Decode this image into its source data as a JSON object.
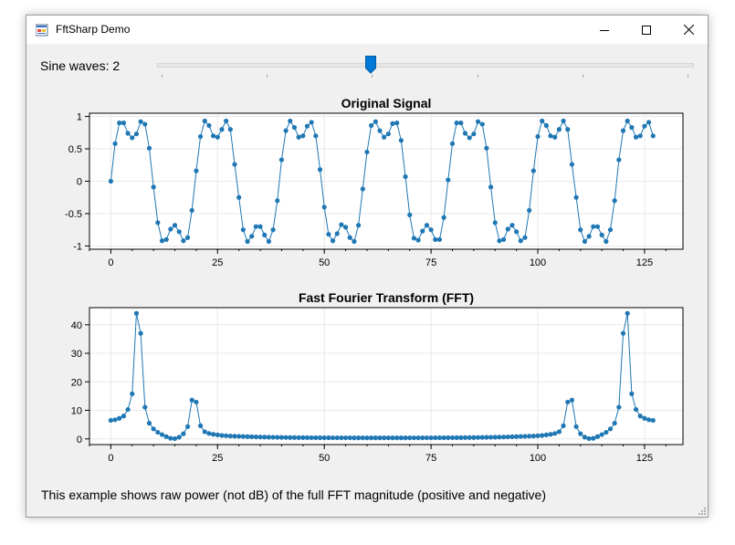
{
  "window": {
    "title": "FftSharp Demo"
  },
  "controls": {
    "sine_label": "Sine waves: 2",
    "slider": {
      "fraction": 0.4,
      "tick_count": 6
    }
  },
  "footer_text": "This example shows raw power (not dB) of the full FFT magnitude (positive and negative)",
  "colors": {
    "series": "#1f77b4",
    "grid": "#e8e8e8",
    "accent": "#0078d7"
  },
  "chart_data": [
    {
      "type": "line",
      "title": "Original Signal",
      "xlim": [
        -5,
        134
      ],
      "ylim": [
        -1.05,
        1.05
      ],
      "xticks": [
        0,
        25,
        50,
        75,
        100,
        125
      ],
      "yticks": [
        1,
        0.5,
        0,
        -0.5,
        -1
      ],
      "ytick_labels": [
        "1",
        "0.5",
        "0",
        "-0.5",
        "-1"
      ],
      "grid": true,
      "series": [
        {
          "y": [
            0,
            0.58,
            0.9,
            0.9,
            0.74,
            0.67,
            0.73,
            0.92,
            0.88,
            0.51,
            -0.09,
            -0.64,
            -0.92,
            -0.9,
            -0.74,
            -0.68,
            -0.78,
            -0.92,
            -0.87,
            -0.45,
            0.16,
            0.69,
            0.93,
            0.86,
            0.7,
            0.68,
            0.8,
            0.93,
            0.8,
            0.26,
            -0.25,
            -0.75,
            -0.93,
            -0.85,
            -0.7,
            -0.7,
            -0.83,
            -0.93,
            -0.75,
            -0.3,
            0.33,
            0.78,
            0.93,
            0.83,
            0.68,
            0.7,
            0.85,
            0.91,
            0.7,
            0.18,
            -0.4,
            -0.82,
            -0.92,
            -0.81,
            -0.67,
            -0.71,
            -0.87,
            -0.93,
            -0.68,
            -0.12,
            0.45,
            0.86,
            0.92,
            0.78,
            0.68,
            0.73,
            0.89,
            0.9,
            0.63,
            0.07,
            -0.52,
            -0.88,
            -0.91,
            -0.77,
            -0.68,
            -0.75,
            -0.9,
            -0.9,
            -0.56,
            0.02,
            0.58,
            0.9,
            0.9,
            0.74,
            0.67,
            0.73,
            0.92,
            0.88,
            0.51,
            -0.09,
            -0.64,
            -0.92,
            -0.9,
            -0.74,
            -0.68,
            -0.78,
            -0.92,
            -0.87,
            -0.45,
            0.16,
            0.69,
            0.93,
            0.86,
            0.7,
            0.68,
            0.8,
            0.93,
            0.8,
            0.26,
            -0.25,
            -0.75,
            -0.93,
            -0.85,
            -0.7,
            -0.7,
            -0.83,
            -0.93,
            -0.75,
            -0.3,
            0.33,
            0.78,
            0.93,
            0.83,
            0.68,
            0.7,
            0.85,
            0.91,
            0.7
          ]
        }
      ]
    },
    {
      "type": "line",
      "title": "Fast Fourier Transform (FFT)",
      "xlim": [
        -5,
        134
      ],
      "ylim": [
        -2,
        46
      ],
      "xticks": [
        0,
        25,
        50,
        75,
        100,
        125
      ],
      "yticks": [
        0,
        10,
        20,
        30,
        40
      ],
      "ytick_labels": [
        "0",
        "10",
        "20",
        "30",
        "40"
      ],
      "grid": true,
      "series": [
        {
          "y": [
            6.5,
            6.7,
            7.2,
            8,
            10.3,
            15.8,
            44,
            37,
            11.1,
            5.5,
            3.5,
            2.3,
            1.5,
            0.8,
            0.2,
            0.1,
            0.6,
            1.8,
            4.3,
            13.6,
            12.9,
            4.6,
            2.5,
            1.9,
            1.6,
            1.4,
            1.2,
            1.1,
            1.0,
            0.95,
            0.9,
            0.85,
            0.8,
            0.75,
            0.7,
            0.66,
            0.63,
            0.6,
            0.57,
            0.55,
            0.52,
            0.5,
            0.48,
            0.47,
            0.45,
            0.44,
            0.43,
            0.42,
            0.41,
            0.4,
            0.39,
            0.39,
            0.38,
            0.38,
            0.37,
            0.37,
            0.37,
            0.36,
            0.36,
            0.36,
            0.36,
            0.36,
            0.36,
            0.36,
            0.36,
            0.36,
            0.36,
            0.36,
            0.36,
            0.36,
            0.36,
            0.37,
            0.37,
            0.37,
            0.38,
            0.38,
            0.39,
            0.39,
            0.4,
            0.41,
            0.42,
            0.43,
            0.44,
            0.45,
            0.47,
            0.48,
            0.5,
            0.52,
            0.55,
            0.57,
            0.6,
            0.63,
            0.66,
            0.7,
            0.75,
            0.8,
            0.85,
            0.9,
            0.95,
            1.0,
            1.1,
            1.2,
            1.4,
            1.6,
            1.9,
            2.5,
            4.6,
            12.9,
            13.6,
            4.3,
            1.8,
            0.6,
            0.1,
            0.2,
            0.8,
            1.5,
            2.3,
            3.5,
            5.5,
            11.1,
            37,
            44,
            15.8,
            10.3,
            8,
            7.2,
            6.7,
            6.5
          ]
        }
      ]
    }
  ]
}
